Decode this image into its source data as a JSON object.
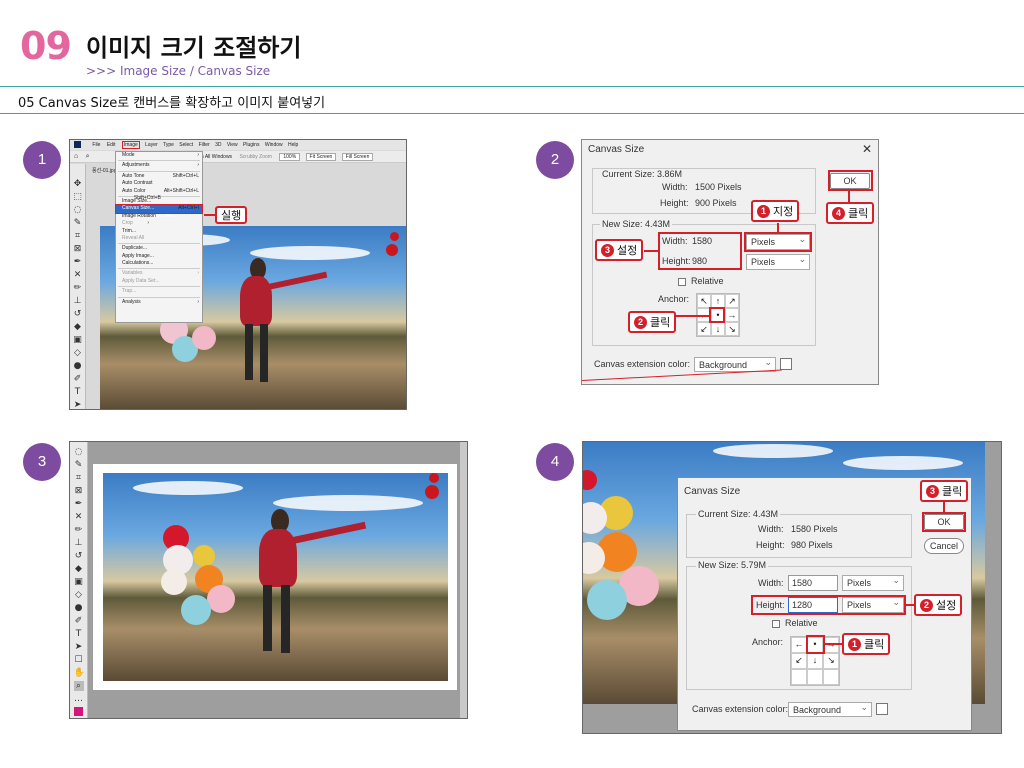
{
  "header": {
    "chapter": "09",
    "title": "이미지 크기 조절하기",
    "subtitle": ">>> Image Size / Canvas Size",
    "step_title": "05 Canvas Size로 캔버스를 확장하고 이미지 붙여넣기"
  },
  "steps": [
    "1",
    "2",
    "3",
    "4"
  ],
  "colors": {
    "accent": "#7d4b9f",
    "chapter": "#e4669e",
    "callout": "#d3202b",
    "rule": "#3aa5a2"
  },
  "panel1": {
    "menubar": [
      "File",
      "Edit",
      "Image",
      "Layer",
      "Type",
      "Select",
      "Filter",
      "3D",
      "View",
      "Plugins",
      "Window",
      "Help"
    ],
    "optionbar": [
      "Zoom All Windows",
      "Scrubby Zoom",
      "100%",
      "Fit Screen",
      "Fill Screen"
    ],
    "tab": "풍선-01.jpg @ 28.7...",
    "menu": [
      {
        "label": "Mode",
        "shortcut": "",
        "state": "normal"
      },
      {
        "sep": true
      },
      {
        "label": "Adjustments",
        "shortcut": "",
        "state": "normal"
      },
      {
        "sep": true
      },
      {
        "label": "Auto Tone",
        "shortcut": "Shift+Ctrl+L",
        "state": "normal"
      },
      {
        "label": "Auto Contrast",
        "shortcut": "Alt+Shift+Ctrl+L",
        "state": "normal"
      },
      {
        "label": "Auto Color",
        "shortcut": "Shift+Ctrl+B",
        "state": "normal"
      },
      {
        "sep": true
      },
      {
        "label": "Image Size...",
        "shortcut": "Alt+Ctrl+I",
        "state": "normal"
      },
      {
        "label": "Canvas Size...",
        "shortcut": "Alt+Ctrl+C",
        "state": "hi"
      },
      {
        "label": "Image Rotation",
        "shortcut": "",
        "state": "normal"
      },
      {
        "label": "Crop",
        "shortcut": "",
        "state": "gray"
      },
      {
        "label": "Trim...",
        "shortcut": "",
        "state": "normal"
      },
      {
        "label": "Reveal All",
        "shortcut": "",
        "state": "gray"
      },
      {
        "sep": true
      },
      {
        "label": "Duplicate...",
        "shortcut": "",
        "state": "normal"
      },
      {
        "label": "Apply Image...",
        "shortcut": "",
        "state": "normal"
      },
      {
        "label": "Calculations...",
        "shortcut": "",
        "state": "normal"
      },
      {
        "sep": true
      },
      {
        "label": "Variables",
        "shortcut": "",
        "state": "gray"
      },
      {
        "label": "Apply Data Set...",
        "shortcut": "",
        "state": "gray"
      },
      {
        "sep": true
      },
      {
        "label": "Trap...",
        "shortcut": "",
        "state": "gray"
      },
      {
        "sep": true
      },
      {
        "label": "Analysis",
        "shortcut": "",
        "state": "normal"
      }
    ],
    "callout": "실행"
  },
  "panel2": {
    "dialog_title": "Canvas Size",
    "close": "✕",
    "current_size": "Current Size: 3.86M",
    "cur_width_label": "Width:",
    "cur_width": "1500 Pixels",
    "cur_height_label": "Height:",
    "cur_height": "900 Pixels",
    "new_size": "New Size: 4.43M",
    "width_label": "Width:",
    "width": "1580",
    "height_label": "Height:",
    "height": "980",
    "unit": "Pixels",
    "relative": "Relative",
    "anchor": "Anchor:",
    "ext_label": "Canvas extension color:",
    "ext_value": "Background",
    "ok": "OK",
    "callout1": "지정",
    "callout2": "클릭",
    "callout3": "설정",
    "callout4": "클릭",
    "n1": "1",
    "n2": "2",
    "n3": "3",
    "n4": "4"
  },
  "panel4": {
    "dialog_title": "Canvas Size",
    "current_size": "Current Size: 4.43M",
    "cur_width_label": "Width:",
    "cur_width": "1580 Pixels",
    "cur_height_label": "Height:",
    "cur_height": "980 Pixels",
    "new_size": "New Size: 5.79M",
    "width_label": "Width:",
    "width": "1580",
    "height_label": "Height:",
    "height": "1280",
    "unit": "Pixels",
    "relative": "Relative",
    "anchor": "Anchor:",
    "ext_label": "Canvas extension color:",
    "ext_value": "Background",
    "ok": "OK",
    "cancel": "Cancel",
    "callout1": "클릭",
    "callout2": "설정",
    "callout3": "클릭",
    "n1": "1",
    "n2": "2",
    "n3": "3"
  },
  "anchor_arrows": {
    "p2": [
      "↖",
      "↑",
      "↗",
      "←",
      "•",
      "→",
      "↙",
      "↓",
      "↘"
    ],
    "p4": [
      "←",
      "•",
      "→",
      "↙",
      "↓",
      "↘",
      "",
      "",
      ""
    ]
  }
}
